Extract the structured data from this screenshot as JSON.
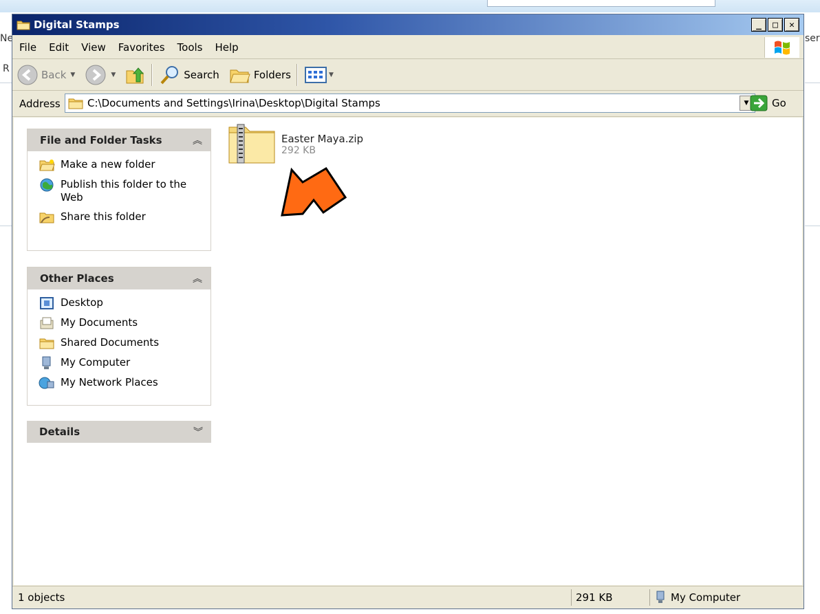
{
  "window": {
    "title": "Digital Stamps"
  },
  "background": {
    "left_fragment_1": "Ne",
    "left_fragment_2": "R",
    "right_fragment": "ser"
  },
  "menu": {
    "items": [
      "File",
      "Edit",
      "View",
      "Favorites",
      "Tools",
      "Help"
    ]
  },
  "toolbar": {
    "back": "Back",
    "search": "Search",
    "folders": "Folders"
  },
  "address": {
    "label": "Address",
    "path": "C:\\Documents and Settings\\Irina\\Desktop\\Digital Stamps",
    "go": "Go"
  },
  "tasks": {
    "file_folder": {
      "title": "File and Folder Tasks",
      "items": [
        {
          "label": "Make a new folder",
          "icon": "new-folder-icon"
        },
        {
          "label": "Publish this folder to the Web",
          "icon": "publish-web-icon"
        },
        {
          "label": "Share this folder",
          "icon": "share-folder-icon"
        }
      ]
    },
    "other_places": {
      "title": "Other Places",
      "items": [
        {
          "label": "Desktop",
          "icon": "desktop-icon"
        },
        {
          "label": "My Documents",
          "icon": "my-documents-icon"
        },
        {
          "label": "Shared Documents",
          "icon": "shared-documents-icon"
        },
        {
          "label": "My Computer",
          "icon": "my-computer-icon"
        },
        {
          "label": "My Network Places",
          "icon": "network-places-icon"
        }
      ]
    },
    "details": {
      "title": "Details"
    }
  },
  "file": {
    "name": "Easter Maya.zip",
    "size": "292 KB"
  },
  "status": {
    "objects": "1 objects",
    "size": "291 KB",
    "location": "My Computer"
  },
  "colors": {
    "title_start": "#0a246a",
    "title_end": "#a6caf0",
    "arrow": "#ff6a13"
  }
}
